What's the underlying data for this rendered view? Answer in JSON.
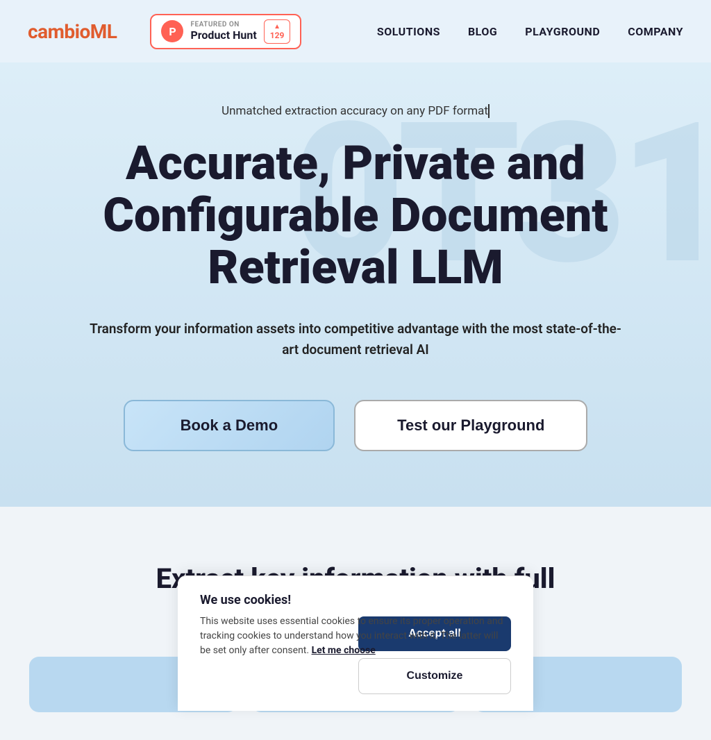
{
  "nav": {
    "logo_cambio": "cambio",
    "logo_ml": "ML",
    "product_hunt": {
      "featured_label": "FEATURED ON",
      "name": "Product Hunt",
      "arrow": "▲",
      "count": "129",
      "ph_letter": "P"
    },
    "links": [
      {
        "label": "SOLUTIONS",
        "id": "solutions"
      },
      {
        "label": "BLOG",
        "id": "blog"
      },
      {
        "label": "PLAYGROUND",
        "id": "playground"
      },
      {
        "label": "COMPANY",
        "id": "company"
      }
    ]
  },
  "hero": {
    "subtitle": "Unmatched extraction accuracy on any PDF format",
    "title": "Accurate, Private and Configurable Document Retrieval LLM",
    "description": "Transform your information assets into competitive advantage with the most state-of-the-art document retrieval AI",
    "btn_demo": "Book a Demo",
    "btn_playground": "Test our Playground",
    "watermark": "0T31"
  },
  "section": {
    "title": "Extract key information with full confidence"
  },
  "cookie": {
    "title": "We use cookies!",
    "text": "This website uses essential cookies to ensure its proper operation and tracking cookies to understand how you interact with it. The latter will be set only after consent.",
    "link_text": "Let me choose",
    "btn_accept": "Accept all",
    "btn_customize": "Customize"
  }
}
